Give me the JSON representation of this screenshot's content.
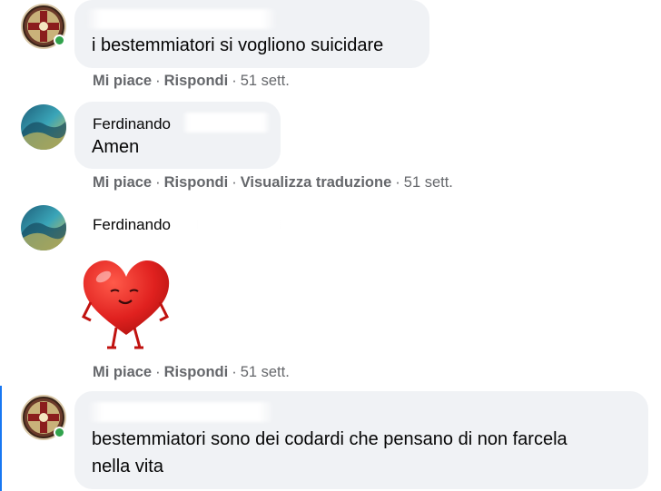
{
  "comments": [
    {
      "author": "",
      "text": "i bestemmiatori si vogliono suicidare",
      "actions": [
        "Mi piace",
        "Rispondi"
      ],
      "time": "51 sett.",
      "online": true,
      "avatar": "saint-benedict-medal-avatar"
    },
    {
      "author": "Ferdinando",
      "text": "Amen",
      "actions": [
        "Mi piace",
        "Rispondi",
        "Visualizza traduzione"
      ],
      "time": "51 sett.",
      "online": false,
      "avatar": "wave-avatar"
    },
    {
      "author": "Ferdinando",
      "sticker": "red-heart-character-sticker",
      "actions": [
        "Mi piace",
        "Rispondi"
      ],
      "time": "51 sett.",
      "online": false,
      "avatar": "wave-avatar"
    },
    {
      "author": "",
      "text": "bestemmiatori sono dei codardi che pensano di non farcela nella vita",
      "text_line1": "bestemmiatori sono dei codardi che pensano di non farcela",
      "text_line2": "nella vita",
      "actions": [],
      "time": "",
      "online": true,
      "avatar": "saint-benedict-medal-avatar"
    }
  ],
  "colors": {
    "bubble": "#f0f2f5",
    "meta_text": "#65676b",
    "online": "#31a24c",
    "heart": "#e0211f"
  },
  "separator": "·"
}
